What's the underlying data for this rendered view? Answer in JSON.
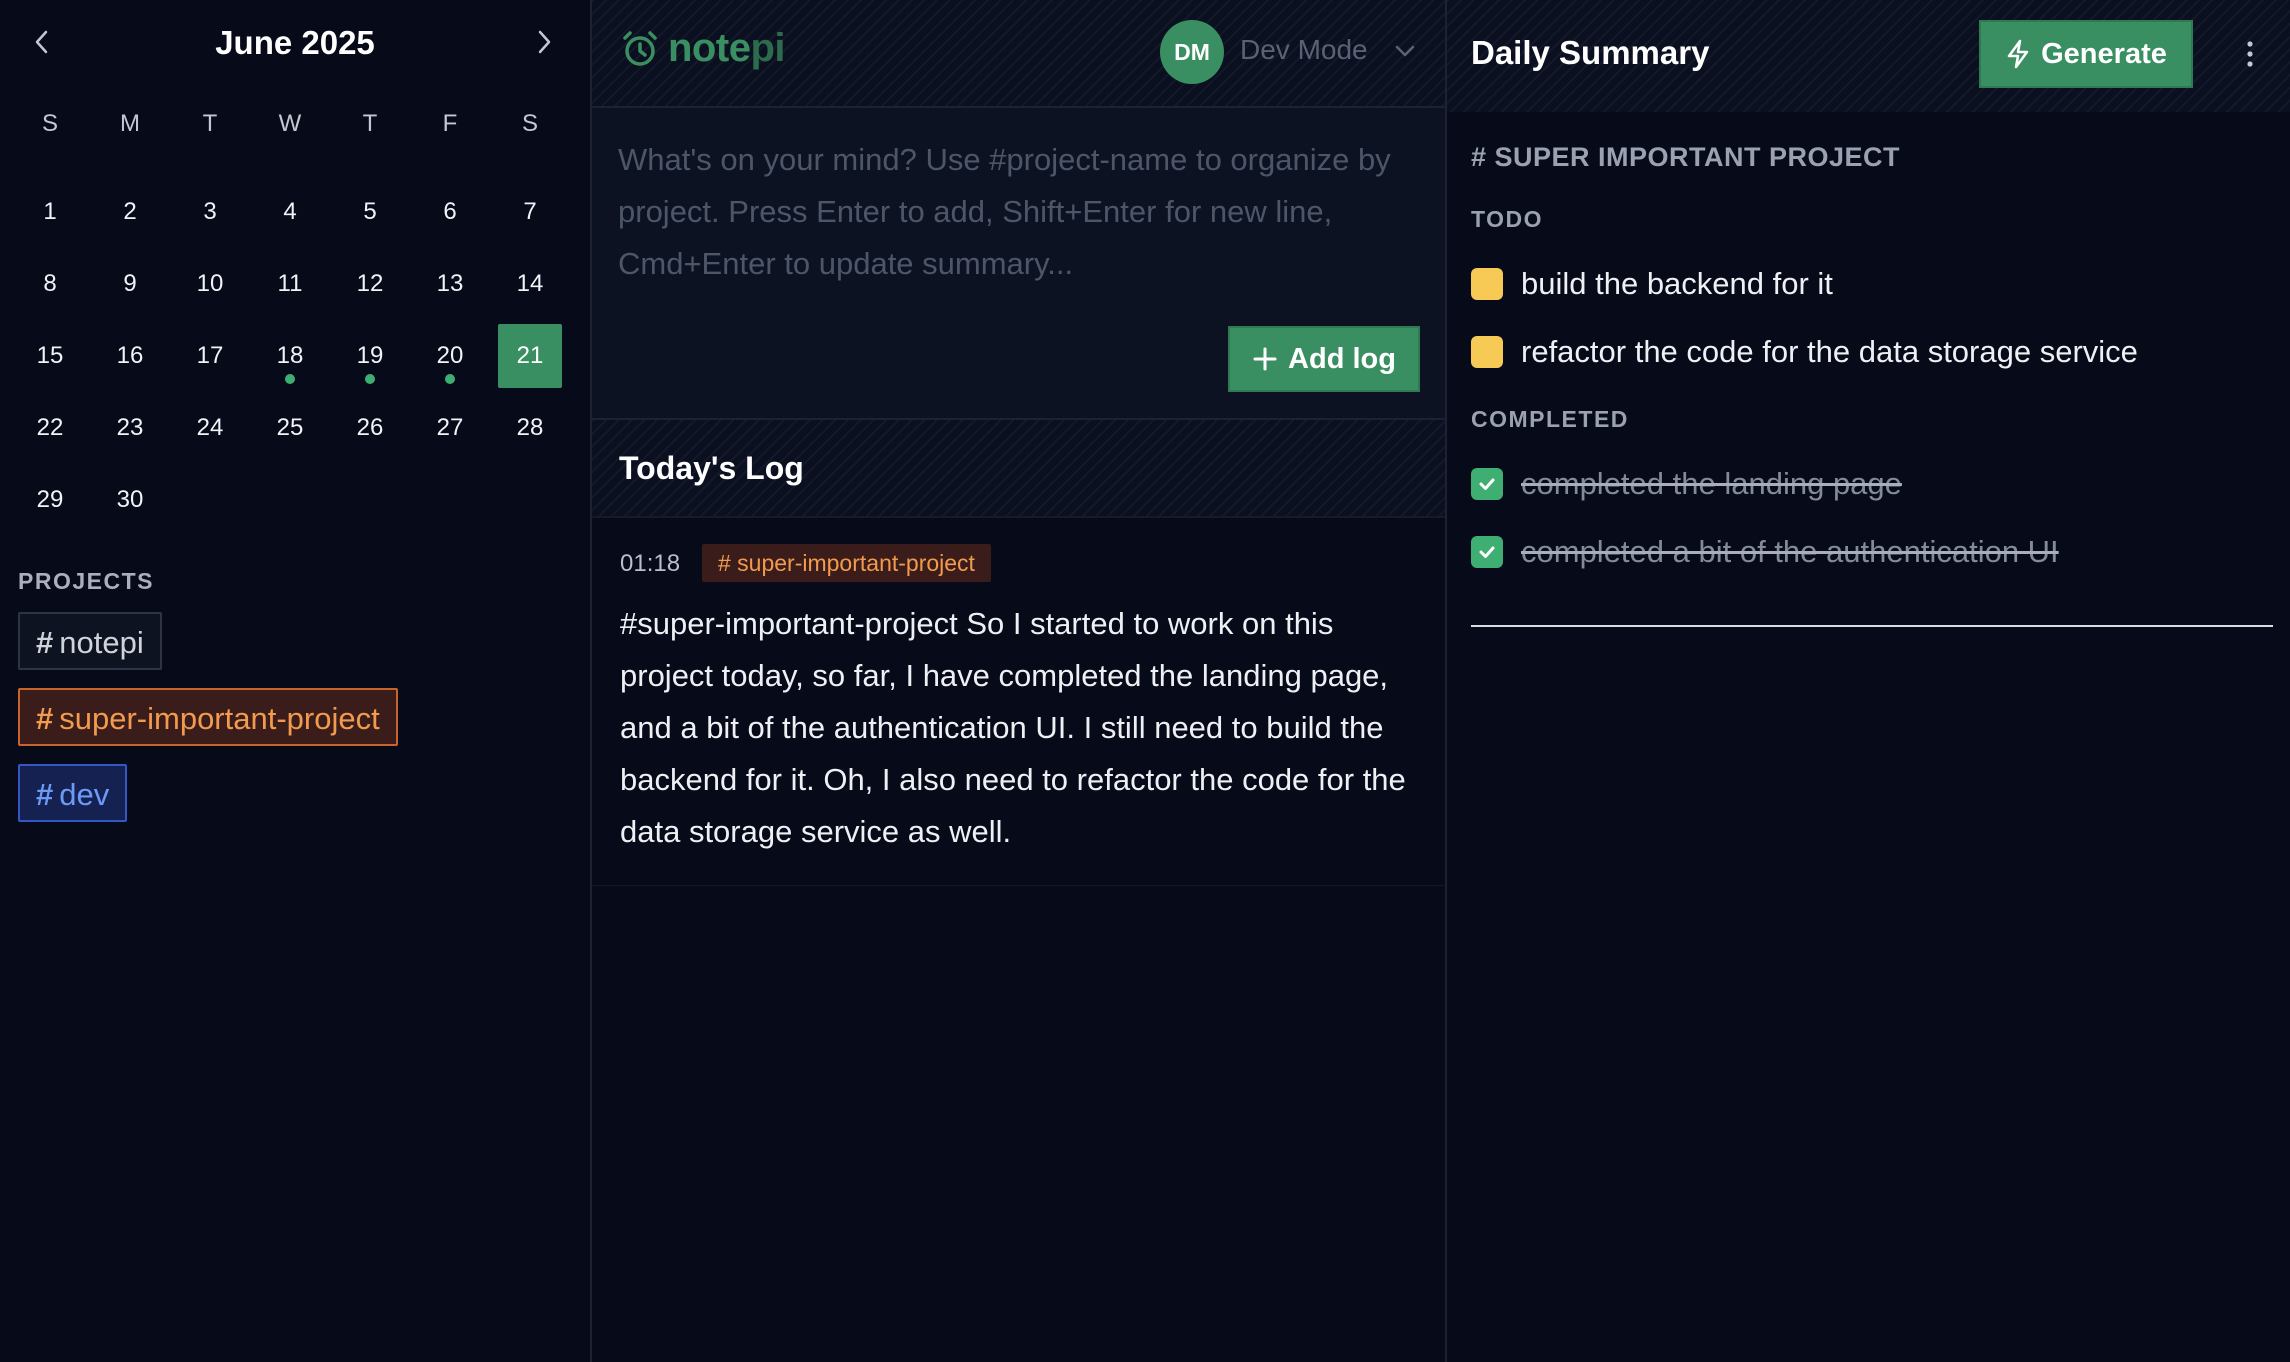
{
  "calendar": {
    "month_title": "June 2025",
    "weekdays": [
      "S",
      "M",
      "T",
      "W",
      "T",
      "F",
      "S"
    ],
    "days": [
      "1",
      "2",
      "3",
      "4",
      "5",
      "6",
      "7",
      "8",
      "9",
      "10",
      "11",
      "12",
      "13",
      "14",
      "15",
      "16",
      "17",
      "18",
      "19",
      "20",
      "21",
      "22",
      "23",
      "24",
      "25",
      "26",
      "27",
      "28",
      "29",
      "30"
    ],
    "first_weekday_index": 0,
    "selected_day": "21",
    "days_with_entries": [
      "18",
      "19",
      "20"
    ]
  },
  "projects": {
    "label": "PROJECTS",
    "items": [
      {
        "hash": "#",
        "name": "notepi",
        "color": "#d0d3da",
        "bg": "#0e1322",
        "border": "#2d3445"
      },
      {
        "hash": "#",
        "name": "super-important-project",
        "color": "#f29a4d",
        "bg": "#3a1d1a",
        "border": "#c8642a"
      },
      {
        "hash": "#",
        "name": "dev",
        "color": "#6d9af6",
        "bg": "#152150",
        "border": "#3557c6"
      }
    ]
  },
  "header": {
    "brand_prefix": "note",
    "brand_suffix": "pi",
    "brand_color": "#3a8f62",
    "brand_suffix_color": "#2c6b4c",
    "avatar_initials": "DM",
    "mode_label": "Dev Mode"
  },
  "composer": {
    "placeholder": "What's on your mind? Use #project-name to organize by project. Press Enter to add, Shift+Enter for new line, Cmd+Enter to update summary...",
    "value": "",
    "add_button_label": "Add log"
  },
  "log": {
    "title": "Today's Log",
    "entries": [
      {
        "time": "01:18",
        "tag": "# super-important-project",
        "text": "#super-important-project So I started to work on this project today, so far, I have completed the landing page, and a bit of the authentication UI. I still need to build the backend for it. Oh, I also need to refactor the code for the data storage service as well."
      }
    ]
  },
  "summary": {
    "title": "Daily Summary",
    "generate_label": "Generate",
    "project_heading": "# SUPER IMPORTANT PROJECT",
    "todo_label": "TODO",
    "todo_items": [
      "build the backend for it",
      "refactor the code for the data storage service"
    ],
    "completed_label": "COMPLETED",
    "completed_items": [
      "completed the landing page",
      "completed a bit of the authentication UI"
    ]
  },
  "colors": {
    "accent_green": "#3a8f62",
    "todo_yellow": "#f6ca55",
    "done_green": "#3fae73",
    "background": "#060a19"
  },
  "icons": {
    "prev": "chevron-left-icon",
    "next": "chevron-right-icon",
    "logo": "alarm-clock-icon",
    "mode": "chevron-down-icon",
    "add": "plus-icon",
    "generate": "lightning-icon",
    "more": "more-vertical-icon",
    "check": "check-icon"
  }
}
